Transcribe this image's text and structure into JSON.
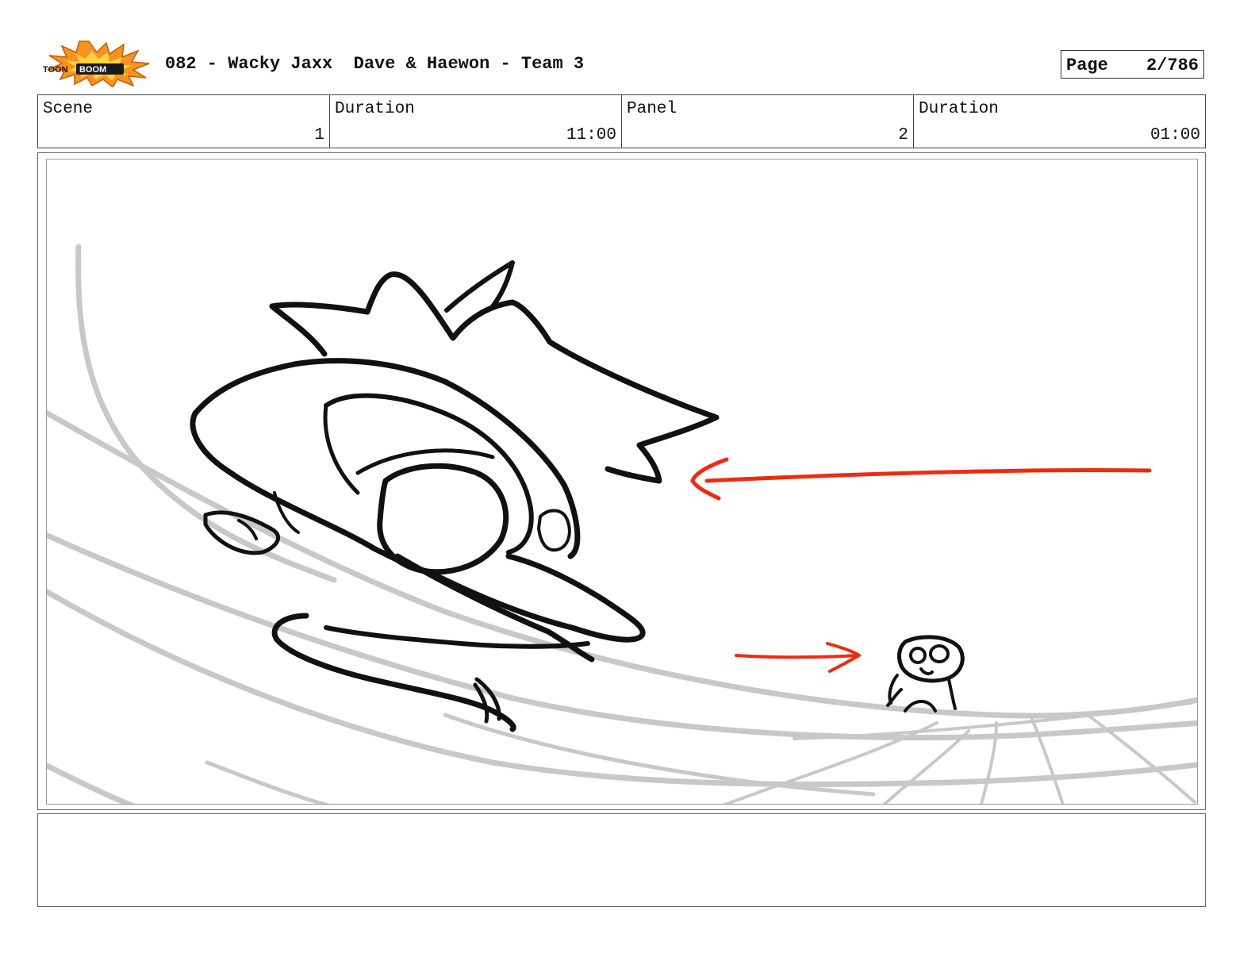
{
  "header": {
    "logo_text_left": "TOON",
    "logo_text_right": "BOOM",
    "title": "082 - Wacky Jaxx  Dave & Haewon - Team 3",
    "page_label": "Page",
    "page_value": "2/786"
  },
  "info": {
    "scene_label": "Scene",
    "scene_value": "1",
    "scene_duration_label": "Duration",
    "scene_duration_value": "11:00",
    "panel_label": "Panel",
    "panel_value": "2",
    "panel_duration_label": "Duration",
    "panel_duration_value": "01:00"
  },
  "panel": {
    "sketch_line_color": "#111111",
    "background_line_color": "#c8c8c8",
    "arrow_color": "#ee2b12"
  },
  "notes": {
    "text": ""
  }
}
